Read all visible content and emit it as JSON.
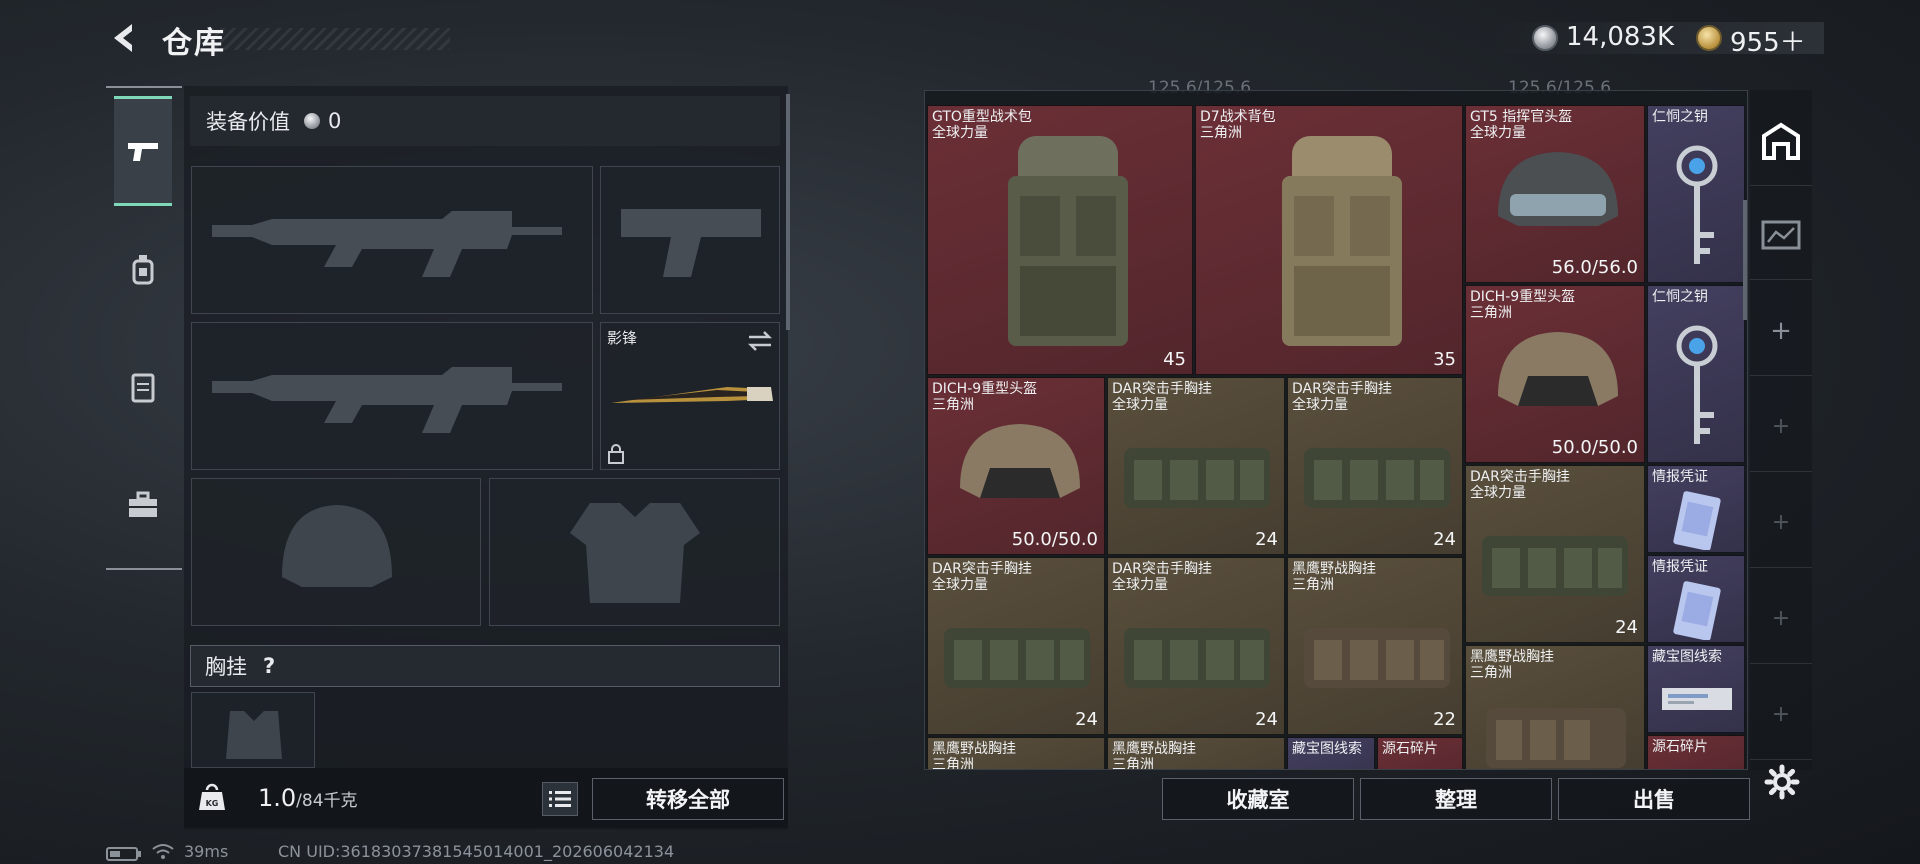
{
  "header": {
    "title": "仓库",
    "currency_silver": "14,083K",
    "currency_gold": "955＋"
  },
  "equipment": {
    "value_label": "装备价值",
    "value": "0",
    "melee_slot_name": "影锋",
    "chest_rig_label": "胸挂",
    "chest_rig_help": "?"
  },
  "weight": {
    "current": "1.0",
    "max": "/84千克"
  },
  "buttons": {
    "transfer_all": "转移全部",
    "collection_room": "收藏室",
    "organize": "整理",
    "sell": "出售"
  },
  "status_bar": {
    "ping": "39ms",
    "uid": "CN UID:36183037381545014001_202606042134"
  },
  "storage": {
    "capacity_left": "125.6/125.6",
    "capacity_right": "125.6/125.6",
    "items": [
      {
        "name": "GTO重型战术包",
        "sub": "全球力量",
        "stat": "45"
      },
      {
        "name": "D7战术背包",
        "sub": "三角洲",
        "stat": "35"
      },
      {
        "name": "GT5 指挥官头盔",
        "sub": "全球力量",
        "stat": "56.0/56.0"
      },
      {
        "name": "仁恫之钥",
        "sub": "",
        "stat": ""
      },
      {
        "name": "DICH-9重型头盔",
        "sub": "三角洲",
        "stat": "50.0/50.0"
      },
      {
        "name": "仁恫之钥",
        "sub": "",
        "stat": ""
      },
      {
        "name": "DICH-9重型头盔",
        "sub": "三角洲",
        "stat": "50.0/50.0"
      },
      {
        "name": "DAR突击手胸挂",
        "sub": "全球力量",
        "stat": "24"
      },
      {
        "name": "DAR突击手胸挂",
        "sub": "全球力量",
        "stat": "24"
      },
      {
        "name": "DAR突击手胸挂",
        "sub": "全球力量",
        "stat": "24"
      },
      {
        "name": "情报凭证",
        "sub": "",
        "stat": ""
      },
      {
        "name": "DAR突击手胸挂",
        "sub": "全球力量",
        "stat": "24"
      },
      {
        "name": "DAR突击手胸挂",
        "sub": "全球力量",
        "stat": "24"
      },
      {
        "name": "黑鹰野战胸挂",
        "sub": "三角洲",
        "stat": "22"
      },
      {
        "name": "情报凭证",
        "sub": "",
        "stat": ""
      },
      {
        "name": "黑鹰野战胸挂",
        "sub": "三角洲",
        "stat": ""
      },
      {
        "name": "藏宝图线索",
        "sub": "",
        "stat": ""
      },
      {
        "name": "黑鹰野战胸挂",
        "sub": "三角洲",
        "stat": ""
      },
      {
        "name": "黑鹰野战胸挂",
        "sub": "三角洲",
        "stat": ""
      },
      {
        "name": "藏宝图线索",
        "sub": "",
        "stat": ""
      },
      {
        "name": "源石碎片",
        "sub": "",
        "stat": ""
      },
      {
        "name": "源石碎片",
        "sub": "",
        "stat": ""
      }
    ]
  },
  "side_rail": {
    "plus": "+"
  },
  "colors": {
    "accent_active": "#7fd9b8",
    "rarity_red": "#6b2f36",
    "rarity_gold": "#5a4f3c",
    "rarity_purple": "#433f5f"
  },
  "icons": [
    "back-arrow-icon",
    "pistol-icon",
    "grenade-icon",
    "vest-icon",
    "toolbox-icon",
    "weight-icon",
    "list-icon",
    "lock-icon",
    "swap-icon",
    "warehouse-icon",
    "map-icon",
    "gear-icon",
    "wifi-icon",
    "battery-icon"
  ]
}
